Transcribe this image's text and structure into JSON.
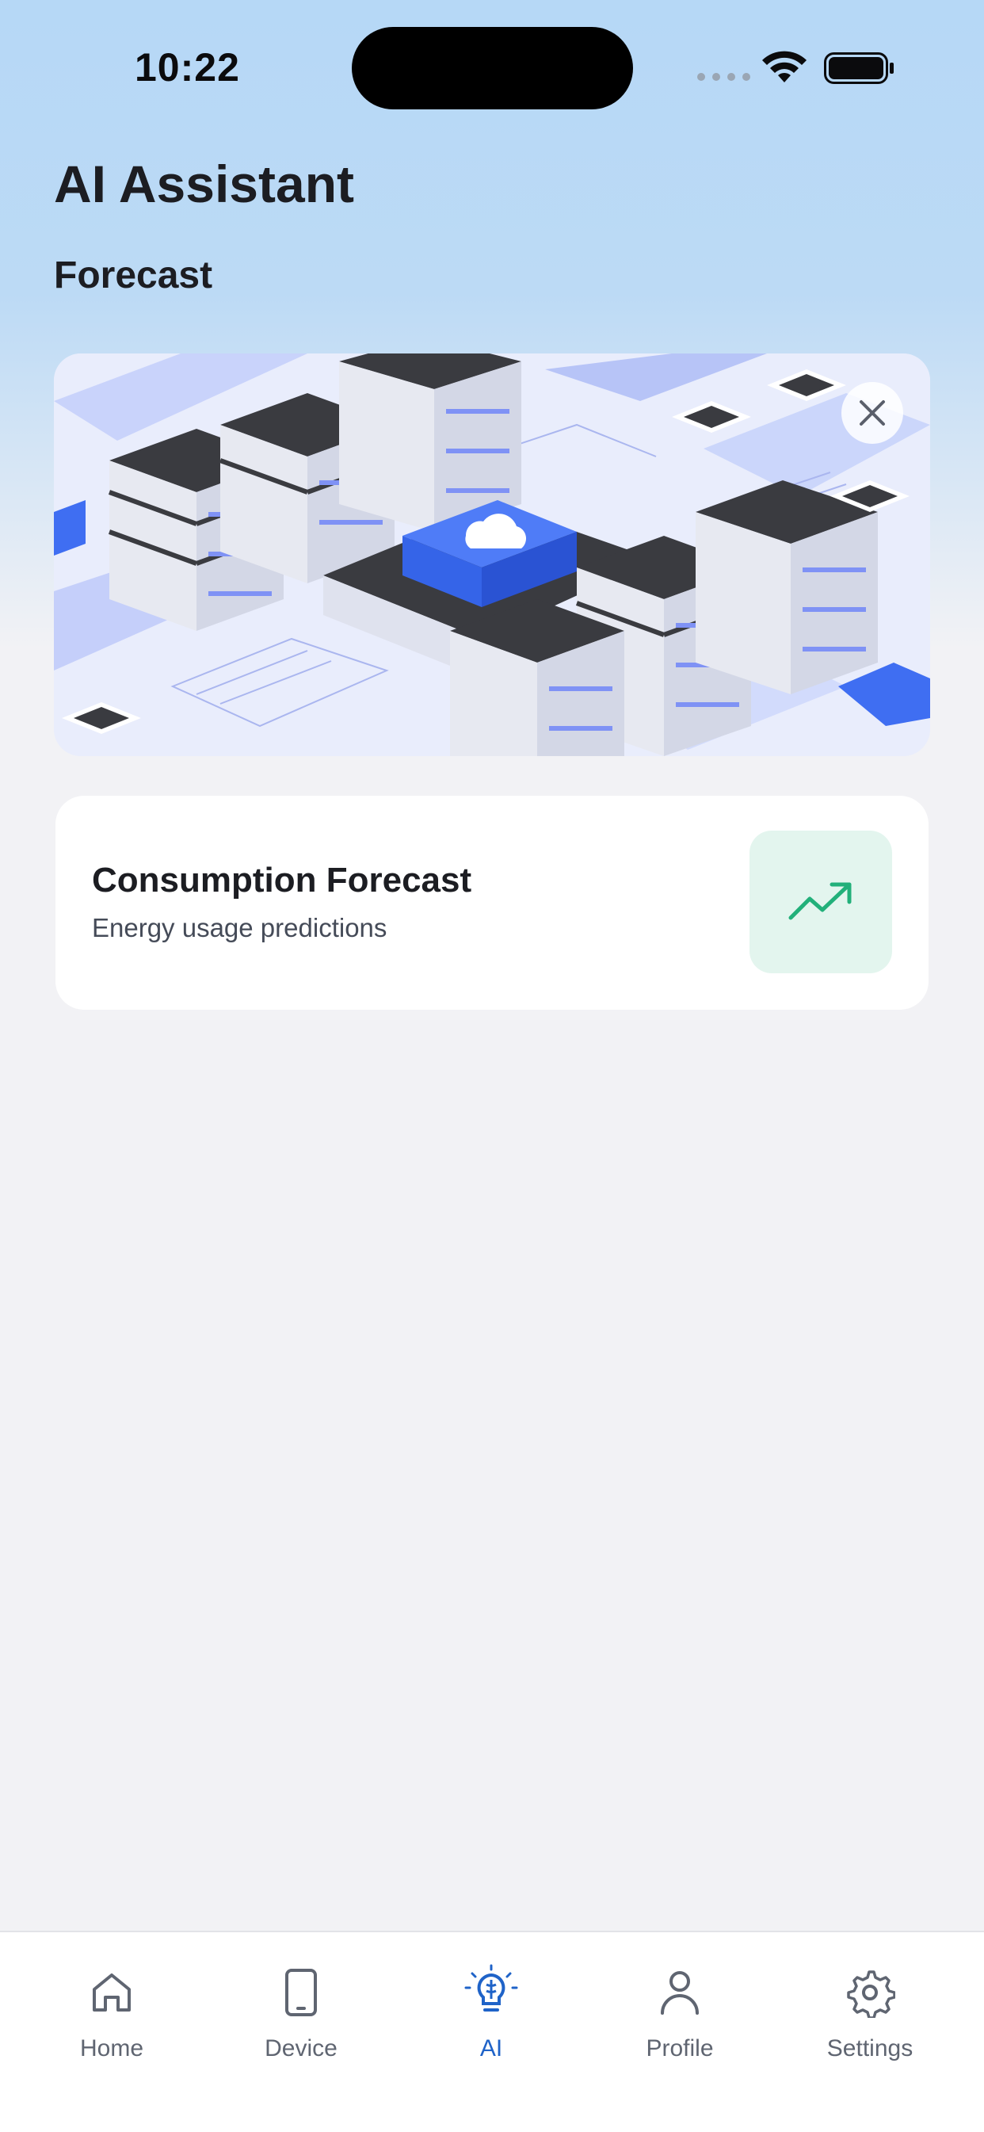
{
  "status_bar": {
    "time": "10:22"
  },
  "header": {
    "title": "AI Assistant",
    "section": "Forecast"
  },
  "card": {
    "title": "Consumption Forecast",
    "subtitle": "Energy usage predictions",
    "icon": "trending-up-icon",
    "accent_color": "#22b07a"
  },
  "tabbar": {
    "active_color": "#1f63c8",
    "tabs": [
      {
        "label": "Home",
        "icon": "home-icon"
      },
      {
        "label": "Device",
        "icon": "device-icon"
      },
      {
        "label": "AI",
        "icon": "ai-bulb-icon",
        "active": true
      },
      {
        "label": "Profile",
        "icon": "person-icon"
      },
      {
        "label": "Settings",
        "icon": "gear-icon"
      }
    ]
  }
}
